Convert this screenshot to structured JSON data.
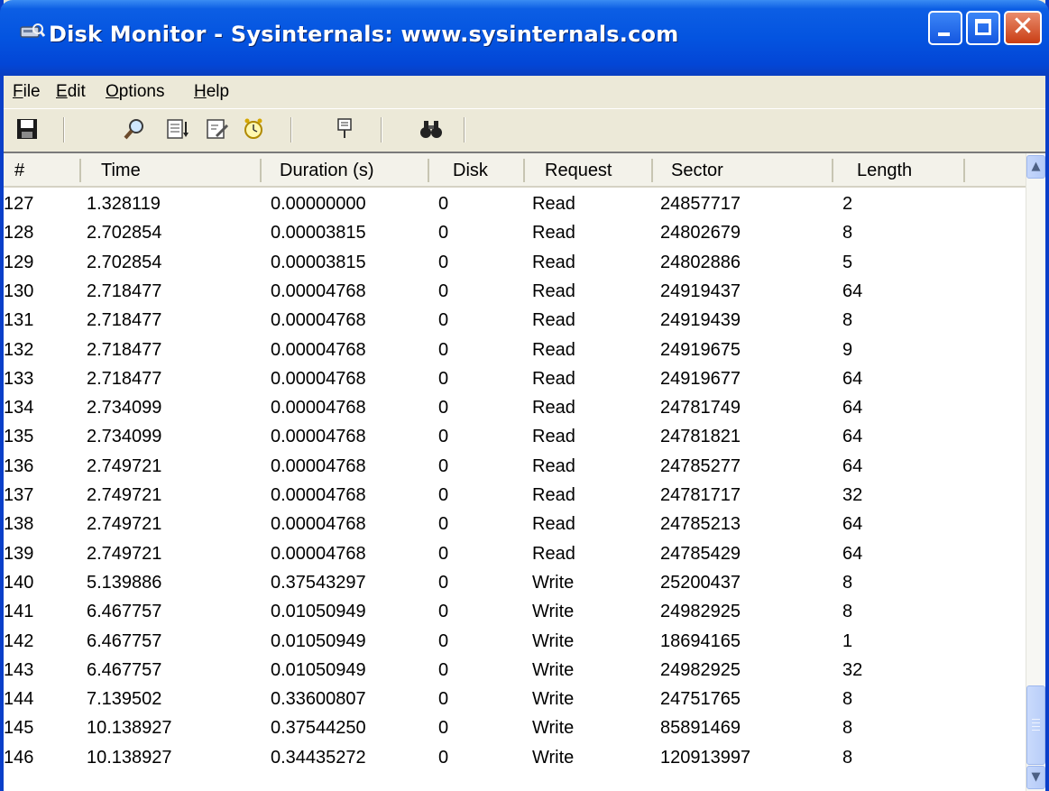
{
  "window": {
    "title": "Disk Monitor - Sysinternals: www.sysinternals.com",
    "title_color": "#ffffff",
    "titlebar_color": "#0454e0",
    "close_button_color": "#c93d14"
  },
  "menu": [
    {
      "pre": "",
      "acc": "F",
      "post": "ile"
    },
    {
      "pre": "",
      "acc": "E",
      "post": "dit"
    },
    {
      "pre": "",
      "acc": "O",
      "post": "ptions"
    },
    {
      "pre": "",
      "acc": "H",
      "post": "elp"
    }
  ],
  "toolbar": {
    "icons": [
      "save-icon",
      "magnifier-icon",
      "autoscroll-icon",
      "clear-icon",
      "timestamp-clock-icon",
      "filter-icon",
      "find-binoculars-icon"
    ]
  },
  "table": {
    "columns": [
      "#",
      "Time",
      "Duration (s)",
      "Disk",
      "Request",
      "Sector",
      "Length"
    ],
    "rows": [
      [
        "127",
        "1.328119",
        "0.00000000",
        "0",
        "Read",
        "24857717",
        "2"
      ],
      [
        "128",
        "2.702854",
        "0.00003815",
        "0",
        "Read",
        "24802679",
        "8"
      ],
      [
        "129",
        "2.702854",
        "0.00003815",
        "0",
        "Read",
        "24802886",
        "5"
      ],
      [
        "130",
        "2.718477",
        "0.00004768",
        "0",
        "Read",
        "24919437",
        "64"
      ],
      [
        "131",
        "2.718477",
        "0.00004768",
        "0",
        "Read",
        "24919439",
        "8"
      ],
      [
        "132",
        "2.718477",
        "0.00004768",
        "0",
        "Read",
        "24919675",
        "9"
      ],
      [
        "133",
        "2.718477",
        "0.00004768",
        "0",
        "Read",
        "24919677",
        "64"
      ],
      [
        "134",
        "2.734099",
        "0.00004768",
        "0",
        "Read",
        "24781749",
        "64"
      ],
      [
        "135",
        "2.734099",
        "0.00004768",
        "0",
        "Read",
        "24781821",
        "64"
      ],
      [
        "136",
        "2.749721",
        "0.00004768",
        "0",
        "Read",
        "24785277",
        "64"
      ],
      [
        "137",
        "2.749721",
        "0.00004768",
        "0",
        "Read",
        "24781717",
        "32"
      ],
      [
        "138",
        "2.749721",
        "0.00004768",
        "0",
        "Read",
        "24785213",
        "64"
      ],
      [
        "139",
        "2.749721",
        "0.00004768",
        "0",
        "Read",
        "24785429",
        "64"
      ],
      [
        "140",
        "5.139886",
        "0.37543297",
        "0",
        "Write",
        "25200437",
        "8"
      ],
      [
        "141",
        "6.467757",
        "0.01050949",
        "0",
        "Write",
        "24982925",
        "8"
      ],
      [
        "142",
        "6.467757",
        "0.01050949",
        "0",
        "Write",
        "18694165",
        "1"
      ],
      [
        "143",
        "6.467757",
        "0.01050949",
        "0",
        "Write",
        "24982925",
        "32"
      ],
      [
        "144",
        "7.139502",
        "0.33600807",
        "0",
        "Write",
        "24751765",
        "8"
      ],
      [
        "145",
        "10.138927",
        "0.37544250",
        "0",
        "Write",
        "85891469",
        "8"
      ],
      [
        "146",
        "10.138927",
        "0.34435272",
        "0",
        "Write",
        "120913997",
        "8"
      ]
    ]
  },
  "scrollbar": {
    "position_fraction": 1.0
  }
}
